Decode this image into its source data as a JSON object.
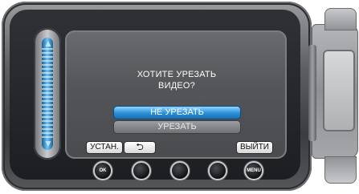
{
  "dialog": {
    "message_line1": "ХОТИТЕ УРЕЗАТЬ",
    "message_line2": "ВИДЕО?",
    "options": [
      {
        "label": "НЕ УРЕЗАТЬ",
        "selected": true
      },
      {
        "label": "УРЕЗАТЬ",
        "selected": false
      }
    ]
  },
  "softkeys": {
    "set_label": "УСТАН.",
    "back_symbol": "⮌",
    "exit_label": "ВЫЙТИ"
  },
  "hardware_buttons": {
    "ok_label": "OK",
    "menu_label": "MENU"
  },
  "icons": {
    "slider_up": "arrow-up-icon",
    "slider_down": "arrow-down-icon",
    "back": "return-arrow-icon"
  },
  "colors": {
    "selected_option": "#2b8fd6",
    "slider_accent": "#6ec5ff",
    "screen_bg": "#545558"
  }
}
